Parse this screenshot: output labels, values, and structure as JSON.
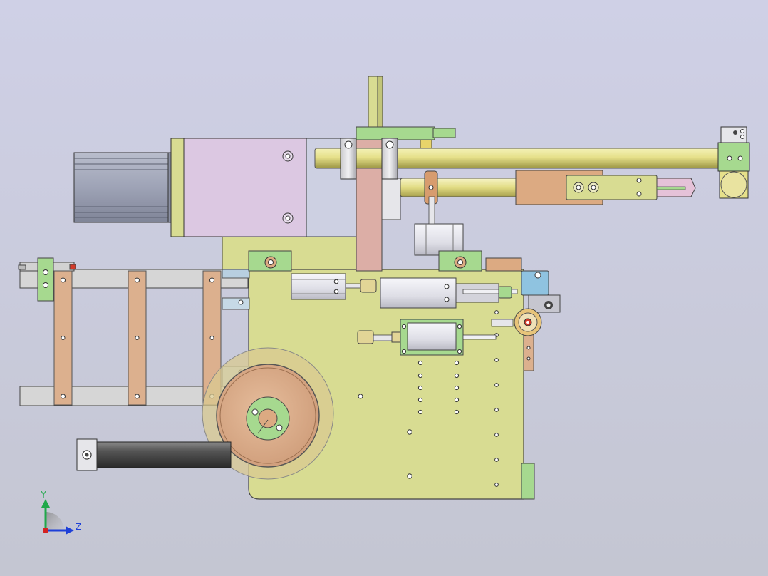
{
  "viewport": {
    "background_top": "#cfd0e6",
    "background_bottom": "#c4c6d2"
  },
  "triad": {
    "y_label": "Y",
    "z_label": "Z",
    "y_color": "#1fa84a",
    "z_color": "#1d3fd8",
    "x_color": "#d42222"
  },
  "palette": {
    "base_plate": "#d8dc92",
    "motor_gray": "#9aa0b4",
    "gearbox_lilac": "#dcc8e2",
    "light_green": "#a6d98f",
    "tan": "#dcb08e",
    "rod_yellow": "#e6e28a",
    "cylinder_silver": "#e4e4ea",
    "outline": "#333333"
  }
}
